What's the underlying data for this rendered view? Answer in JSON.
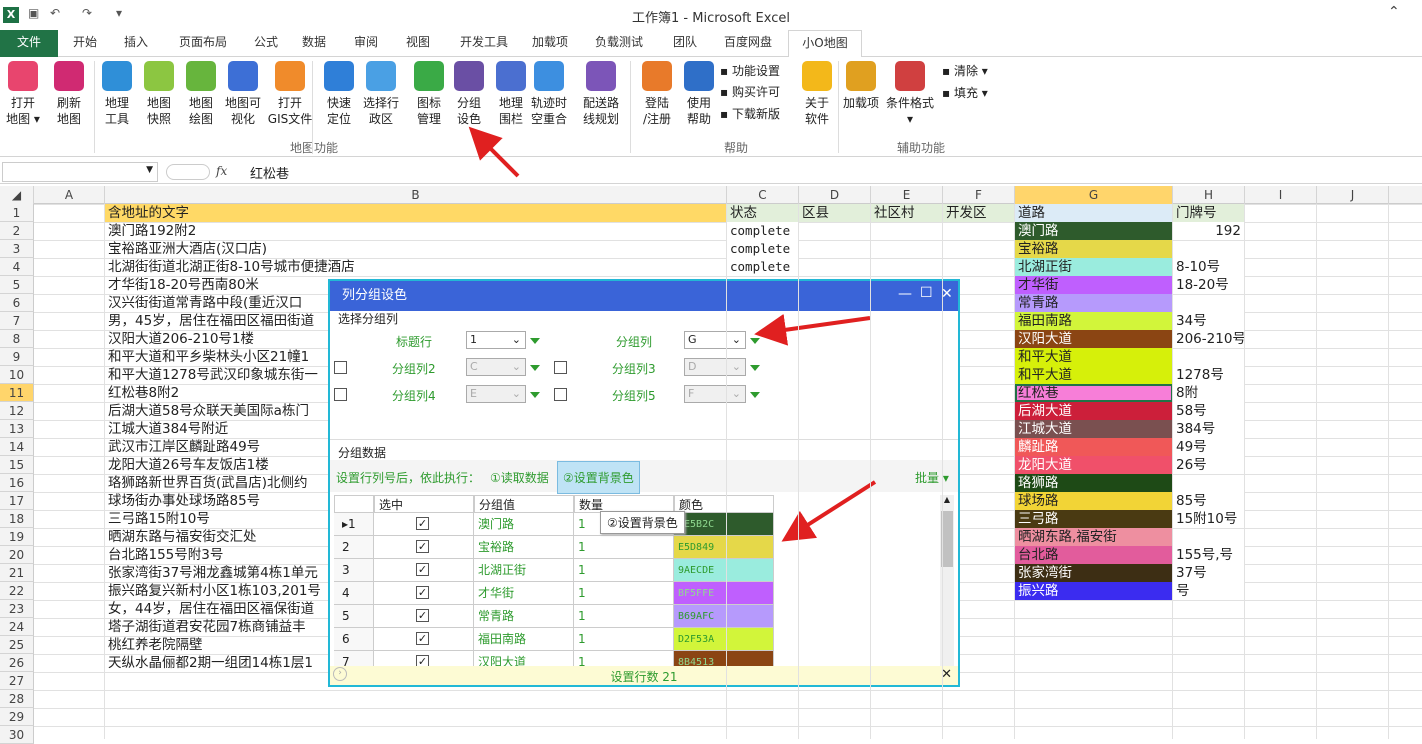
{
  "app": {
    "title": "工作簿1 - Microsoft Excel",
    "qat": [
      "↶",
      "↷"
    ]
  },
  "tabs": [
    "文件",
    "开始",
    "插入",
    "页面布局",
    "公式",
    "数据",
    "审阅",
    "视图",
    "开发工具",
    "加载项",
    "负载测试",
    "团队",
    "百度网盘",
    "小O地图"
  ],
  "ribbon": {
    "buttons": [
      {
        "label1": "打开",
        "label2": "地图 ▾",
        "color": "#e8456e"
      },
      {
        "label1": "刷新",
        "label2": "地图",
        "color": "#d02a72"
      },
      {
        "label1": "地理",
        "label2": "工具",
        "color": "#2f8fd8"
      },
      {
        "label1": "地图",
        "label2": "快照",
        "color": "#8cc641"
      },
      {
        "label1": "地图",
        "label2": "绘图",
        "color": "#67b53d"
      },
      {
        "label1": "地图可",
        "label2": "视化",
        "color": "#3d6fd6"
      },
      {
        "label1": "打开",
        "label2": "GIS文件",
        "color": "#f08b2b"
      },
      {
        "label1": "快速",
        "label2": "定位",
        "color": "#2f7fd8"
      },
      {
        "label1": "选择行",
        "label2": "政区",
        "color": "#4aa0e4"
      },
      {
        "label1": "图标",
        "label2": "管理",
        "color": "#3aaa46"
      },
      {
        "label1": "分组",
        "label2": "设色",
        "color": "#6a4fa4"
      },
      {
        "label1": "地理",
        "label2": "围栏",
        "color": "#4b6fd0"
      },
      {
        "label1": "轨迹时",
        "label2": "空重合",
        "color": "#3d8fe0"
      },
      {
        "label1": "配送路",
        "label2": "线规划",
        "color": "#7c55b8"
      },
      {
        "label1": "登陆",
        "label2": "/注册",
        "color": "#e87a2a"
      },
      {
        "label1": "使用",
        "label2": "帮助",
        "color": "#2f6fc8"
      },
      {
        "label1": "关于",
        "label2": "软件",
        "color": "#f3b81a"
      },
      {
        "label1": "加载项",
        "label2": "",
        "color": "#e0a020"
      },
      {
        "label1": "条件格式",
        "label2": "▾",
        "color": "#d04040"
      }
    ],
    "small": [
      "功能设置",
      "购买许可",
      "下载新版",
      "清除 ▾",
      "填充 ▾"
    ],
    "groups": [
      "地图功能",
      "帮助",
      "辅助功能"
    ]
  },
  "formula": {
    "fx": "fx",
    "value": "红松巷"
  },
  "columns": [
    "A",
    "B",
    "C",
    "D",
    "E",
    "F",
    "G",
    "H",
    "I",
    "J"
  ],
  "rows": [
    "1",
    "2",
    "3",
    "4",
    "5",
    "6",
    "7",
    "8",
    "9",
    "10",
    "11",
    "12",
    "13",
    "14",
    "15",
    "16",
    "17",
    "18",
    "19",
    "20",
    "21",
    "22",
    "23",
    "24",
    "25",
    "26",
    "27",
    "28",
    "29",
    "30"
  ],
  "sheet": {
    "headers": {
      "B": "含地址的文字",
      "C": "状态",
      "D": "区县",
      "E": "社区村",
      "F": "开发区",
      "G": "道路",
      "H": "门牌号"
    },
    "B": [
      "澳门路192附2",
      "宝裕路亚洲大酒店(汉口店)",
      "北湖街街道北湖正街8-10号城市便捷酒店",
      "才华街18-20号西南80米",
      "汉兴街街道常青路中段(重近汉口",
      "男，45岁，居住在福田区福田街道",
      "汉阳大道206-210号1楼",
      "和平大道和平乡柴林头小区21幢1",
      "和平大道1278号武汉印象城东街一",
      "红松巷8附2",
      "后湖大道58号众联天美国际a栋门",
      "江城大道384号附近",
      "武汉市江岸区麟趾路49号",
      "龙阳大道26号车友饭店1楼",
      "珞狮路新世界百货(武昌店)北侧约",
      "球场街办事处球场路85号",
      "三弓路15附10号",
      "晒湖东路与福安街交汇处",
      "台北路155号附3号",
      "张家湾街37号湘龙鑫城第4栋1单元",
      "振兴路复兴新村小区1栋103,201号",
      "女，44岁，居住在福田区福保街道",
      "塔子湖街道君安花园7栋商铺益丰",
      "桃红养老院隔壁",
      "天纵水晶俪都2期一组团14栋1层1"
    ],
    "C": [
      "complete",
      "complete",
      "complete"
    ],
    "G": [
      "澳门路",
      "宝裕路",
      "北湖正街",
      "才华街",
      "常青路",
      "福田南路",
      "汉阳大道",
      "和平大道",
      "和平大道",
      "红松巷",
      "后湖大道",
      "江城大道",
      "麟趾路",
      "龙阳大道",
      "珞狮路",
      "球场路",
      "三弓路",
      "晒湖东路,福安街",
      "台北路",
      "张家湾街",
      "振兴路"
    ],
    "Gcolors": [
      "#2E5B2C",
      "#E5D849",
      "#9AECDE",
      "#BF5FFE",
      "#B69AFC",
      "#D2F53A",
      "#8B4513",
      "#D6F00A",
      "#D6F00A",
      "#F77ED8",
      "#CC1F3A",
      "#7A5050",
      "#F05858",
      "#F0506A",
      "#1E4A16",
      "#F2D436",
      "#4A3A12",
      "#EE8FA0",
      "#E25C9C",
      "#3D2E14",
      "#3B2CF0"
    ],
    "H": [
      "192",
      "",
      "8-10号",
      "18-20号",
      "",
      "34号",
      "206-210号",
      "",
      "1278号",
      "8附",
      "58号",
      "384号",
      "49号",
      "26号",
      "",
      "85号",
      "15附10号",
      "",
      "155号,号",
      "37号",
      "号"
    ]
  },
  "dialog": {
    "title": "列分组设色",
    "section1": "选择分组列",
    "header_row_label": "标题行",
    "header_row_value": "1",
    "group_col_label": "分组列",
    "group_col_value": "G",
    "group2_label": "分组列2",
    "group2_value": "C",
    "group3_label": "分组列3",
    "group3_value": "D",
    "group4_label": "分组列4",
    "group4_value": "E",
    "group5_label": "分组列5",
    "group5_value": "F",
    "section2": "分组数据",
    "instruction": "设置行列号后，依此执行：",
    "step1": "①读取数据",
    "step2": "②设置背景色",
    "batch": "批量 ▾",
    "tooltip": "②设置背景色",
    "cols": [
      "选中",
      "分组值",
      "数量",
      "颜色"
    ],
    "rows": [
      {
        "n": "1",
        "v": "澳门路",
        "c": "1",
        "hex": "2E5B2C"
      },
      {
        "n": "2",
        "v": "宝裕路",
        "c": "1",
        "hex": "E5D849"
      },
      {
        "n": "3",
        "v": "北湖正街",
        "c": "1",
        "hex": "9AECDE"
      },
      {
        "n": "4",
        "v": "才华街",
        "c": "1",
        "hex": "BF5FFE"
      },
      {
        "n": "5",
        "v": "常青路",
        "c": "1",
        "hex": "B69AFC"
      },
      {
        "n": "6",
        "v": "福田南路",
        "c": "1",
        "hex": "D2F53A"
      },
      {
        "n": "7",
        "v": "汉阳大道",
        "c": "1",
        "hex": "8B4513"
      }
    ],
    "status": "设置行数 21"
  },
  "colors": {
    "excel_green": "#217346",
    "dialog_blue": "#3a64d8",
    "dialog_border": "#22b8d6",
    "header_fill": "#ffd966",
    "header_fill2": "#e2efda",
    "arrow": "#e02020"
  }
}
